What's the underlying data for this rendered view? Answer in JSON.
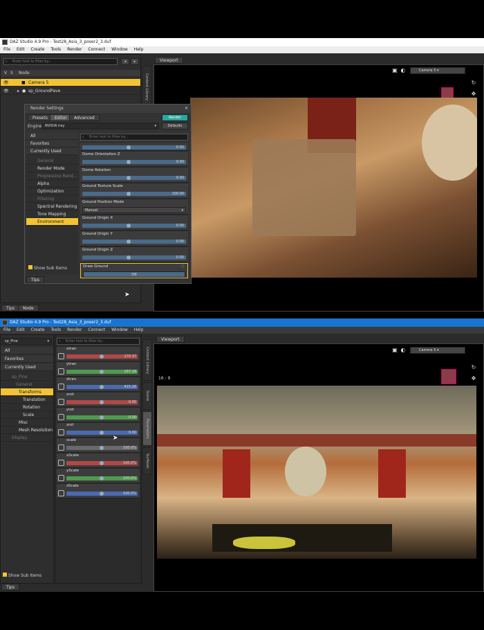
{
  "top": {
    "title": "DAZ Studio 4.9 Pro - Test28_Asia_3_poser2_3.duf",
    "menu": [
      "File",
      "Edit",
      "Create",
      "Tools",
      "Render",
      "Connect",
      "Window",
      "Help"
    ],
    "scene_filter_placeholder": "Enter text to filter by...",
    "scene_cols": {
      "v": "V",
      "s": "S",
      "node": "Node"
    },
    "scene_rows": [
      "Camera 5",
      "sp_GroundPave"
    ],
    "side_tabs": [
      "Content Library"
    ],
    "bottom_tabs": [
      "Tips",
      "Node"
    ],
    "viewport_tab": "Viewport",
    "camera": "Camera 5",
    "render_settings": {
      "title": "Render Settings",
      "tabs": [
        "Presets",
        "Editor",
        "Advanced"
      ],
      "render_btn": "Render",
      "engine_label": "Engine",
      "engine": "NVIDIA Iray",
      "defaults_btn": "Defaults",
      "filter_placeholder": "Enter text to filter by...",
      "cats": [
        "All",
        "Favorites",
        "Currently Used"
      ],
      "tree": [
        "General",
        "Render Mode",
        "Progressive Rend...",
        "Alpha",
        "Optimization",
        "Filtering",
        "Spectral Rendering",
        "Tone Mapping",
        "Environment"
      ],
      "show_sub": "Show Sub Items",
      "tips": "Tips",
      "props": [
        {
          "label": "",
          "value": "0.00"
        },
        {
          "label": "Dome Orientation Z",
          "value": "0.00"
        },
        {
          "label": "Dome Rotation",
          "value": "0.00"
        },
        {
          "label": "Ground Texture Scale",
          "value": "100.00"
        },
        {
          "label": "Ground Position Mode",
          "value": "Manual"
        },
        {
          "label": "Ground Origin X",
          "value": "0.00"
        },
        {
          "label": "Ground Origin Y",
          "value": "0.00"
        },
        {
          "label": "Ground Origin Z",
          "value": "0.00"
        },
        {
          "label": "Draw Ground",
          "value": "Off"
        }
      ]
    }
  },
  "bottom": {
    "title": "DAZ Studio 4.9 Pro - Test28_Asia_3_poser2_3.duf",
    "menu": [
      "File",
      "Edit",
      "Create",
      "Tools",
      "Render",
      "Connect",
      "Window",
      "Help"
    ],
    "node_select": "sp_Pine",
    "filter_placeholder": "Enter text to filter by...",
    "cats": [
      "All",
      "Favorites",
      "Currently Used"
    ],
    "tree_root": "sp_Pine",
    "tree": [
      "General",
      "Transforms",
      "Translation",
      "Rotation",
      "Scale",
      "Misc",
      "Mesh Resolution",
      "Display"
    ],
    "show_sub": "Show Sub Items",
    "tips": "Tips",
    "side_tabs": [
      "Content Library",
      "Scene",
      "Parameters",
      "Surfaces"
    ],
    "viewport_tab": "Viewport",
    "camera": "Camera 5",
    "aspect": "16 : 9",
    "params": [
      {
        "label": "xtran",
        "value": "170.37"
      },
      {
        "label": "ytran",
        "value": "167.18"
      },
      {
        "label": "ztran",
        "value": "415.26"
      },
      {
        "label": "xrot",
        "value": "0.00"
      },
      {
        "label": "yrot",
        "value": "0.00"
      },
      {
        "label": "zrot",
        "value": "0.00"
      },
      {
        "label": "scale",
        "value": "150.0%"
      },
      {
        "label": "xScale",
        "value": "100.0%"
      },
      {
        "label": "yScale",
        "value": "100.0%"
      },
      {
        "label": "zScale",
        "value": "100.0%"
      }
    ]
  }
}
